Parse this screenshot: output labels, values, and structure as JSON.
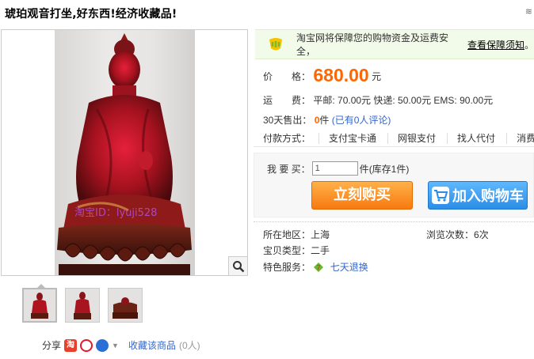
{
  "title": "琥珀观音打坐,好东西!经济收藏品!",
  "corner_text": "≋",
  "watermark": "淘宝ID：lyuji528",
  "guarantee": {
    "text": "淘宝网将保障您的购物资金及运费安全，",
    "link": "查看保障须知",
    "tail": "。"
  },
  "price": {
    "label": "价　　格：",
    "value": "680.00",
    "unit": "元"
  },
  "shipping": {
    "label": "运　　费：",
    "text": "平邮: 70.00元 快递: 50.00元 EMS: 90.00元"
  },
  "sales": {
    "label": "30天售出：",
    "count": "0",
    "unit": "件",
    "reviews": "(已有0人评论)"
  },
  "payment": {
    "label": "付款方式：",
    "methods": [
      "支付宝卡通",
      "网银支付",
      "找人代付",
      "消费"
    ]
  },
  "buy": {
    "qty_label": "我 要 买：",
    "qty_value": "1",
    "qty_unit": "件",
    "stock": "(库存1件)",
    "buy_button": "立刻购买",
    "cart_button": "加入购物车"
  },
  "info": {
    "location_label": "所在地区：",
    "location": "上海",
    "views_label": "浏览次数：",
    "views": "6次",
    "type_label": "宝贝类型：",
    "type": "二手",
    "service_label": "特色服务：",
    "service": "七天退换"
  },
  "share": {
    "label": "分享",
    "fav_link": "收藏该商品",
    "fav_count": "(0人)"
  },
  "colors": {
    "price": "#ff6600",
    "link": "#3366cc",
    "buy_btn": "#f77a10",
    "cart_btn": "#2b8de6",
    "amber": "#9e1620"
  }
}
